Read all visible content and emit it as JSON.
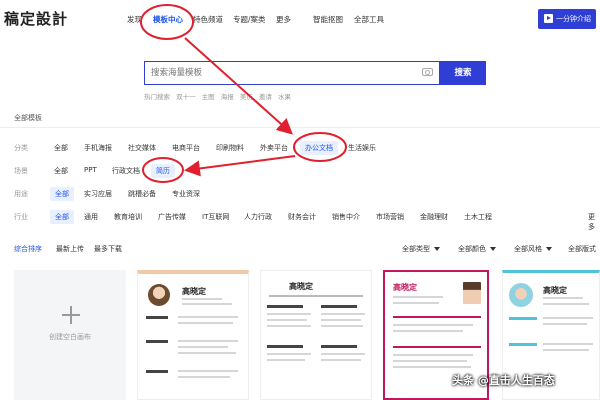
{
  "header": {
    "logo": "稿定設計",
    "nav": [
      "发现",
      "模板中心",
      "特色频道",
      "专题/案类",
      "更多",
      "智能抠图",
      "全部工具"
    ],
    "intro_button": "一分钟介绍"
  },
  "search": {
    "placeholder": "搜索海量模板",
    "button": "搜索",
    "hot": [
      "热门搜索",
      "双十一",
      "主图",
      "海报",
      "美历",
      "邀请",
      "水果"
    ]
  },
  "filters": {
    "all_templates": "全部模板",
    "category": {
      "label": "分类",
      "options": [
        "全部",
        "手机海报",
        "社交媒体",
        "电商平台",
        "印刷物料",
        "外卖平台",
        "办公文档",
        "生活娱乐"
      ],
      "selected": "办公文档"
    },
    "scene": {
      "label": "场景",
      "options": [
        "全部",
        "PPT",
        "行政文档",
        "简历"
      ],
      "selected": "简历"
    },
    "usage": {
      "label": "用途",
      "options": [
        "全部",
        "实习应届",
        "跳槽必备",
        "专业资深"
      ],
      "selected": "全部"
    },
    "industry": {
      "label": "行业",
      "options": [
        "全部",
        "通用",
        "教育培训",
        "广告传媒",
        "IT互联网",
        "人力行政",
        "财务会计",
        "销售中介",
        "市场营销",
        "金融理财",
        "土木工程"
      ],
      "selected": "全部",
      "more": "更多"
    }
  },
  "sort": {
    "options": [
      "综合排序",
      "最新上传",
      "最多下载"
    ],
    "selected": "综合排序",
    "dropdowns": [
      "全部类型",
      "全部颜色",
      "全部风格",
      "全部版式"
    ]
  },
  "cards": {
    "blank_label": "创建空白画布",
    "resume_names": [
      "高晓定",
      "高晓定",
      "高晓定",
      "高晓定"
    ]
  },
  "watermark": "头条 @直击人生百态",
  "colors": {
    "accent": "#2f3fd6",
    "annotation": "#e0202f",
    "selected_bg": "#e8effe"
  }
}
